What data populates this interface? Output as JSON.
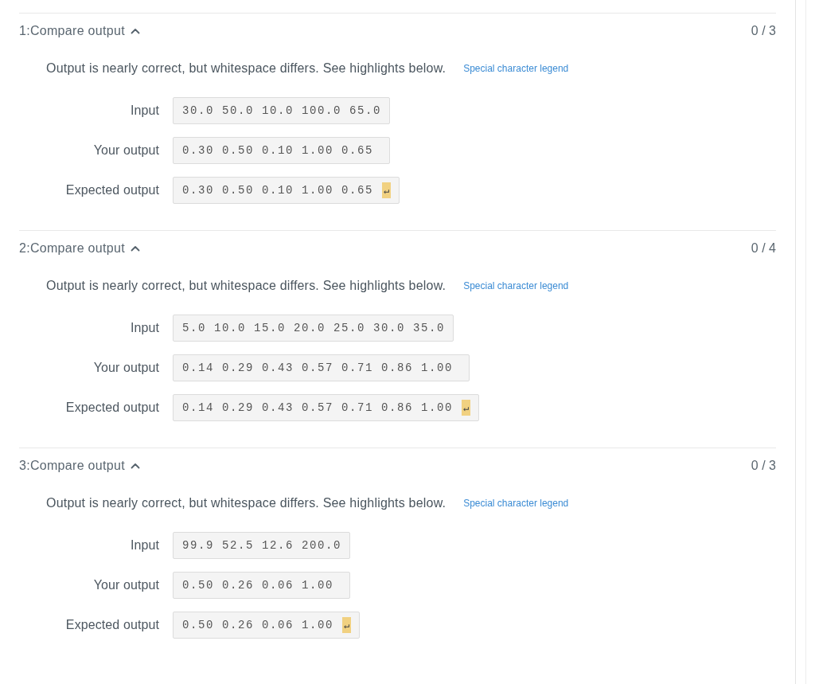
{
  "tests": [
    {
      "title": "1:Compare output",
      "expanded": true,
      "score": "0 / 3",
      "message": "Output is nearly correct, but whitespace differs. See highlights below.",
      "legend_link": "Special character legend",
      "rows": [
        {
          "label": "Input",
          "value": "30.0 50.0 10.0 100.0 65.0"
        },
        {
          "label": "Your output",
          "value": "0.30 0.50 0.10 1.00 0.65 "
        },
        {
          "label": "Expected output",
          "value": "0.30 0.50 0.10 1.00 0.65",
          "marker": "↵"
        }
      ]
    },
    {
      "title": "2:Compare output",
      "expanded": true,
      "score": "0 / 4",
      "message": "Output is nearly correct, but whitespace differs. See highlights below.",
      "legend_link": "Special character legend",
      "rows": [
        {
          "label": "Input",
          "value": "5.0 10.0 15.0 20.0 25.0 30.0 35.0"
        },
        {
          "label": "Your output",
          "value": "0.14 0.29 0.43 0.57 0.71 0.86 1.00 "
        },
        {
          "label": "Expected output",
          "value": "0.14 0.29 0.43 0.57 0.71 0.86 1.00",
          "marker": "↵"
        }
      ]
    },
    {
      "title": "3:Compare output",
      "expanded": true,
      "score": "0 / 3",
      "message": "Output is nearly correct, but whitespace differs. See highlights below.",
      "legend_link": "Special character legend",
      "rows": [
        {
          "label": "Input",
          "value": "99.9 52.5 12.6 200.0"
        },
        {
          "label": "Your output",
          "value": "0.50 0.26 0.06 1.00 "
        },
        {
          "label": "Expected output",
          "value": "0.50 0.26 0.06 1.00",
          "marker": "↵"
        }
      ]
    }
  ]
}
